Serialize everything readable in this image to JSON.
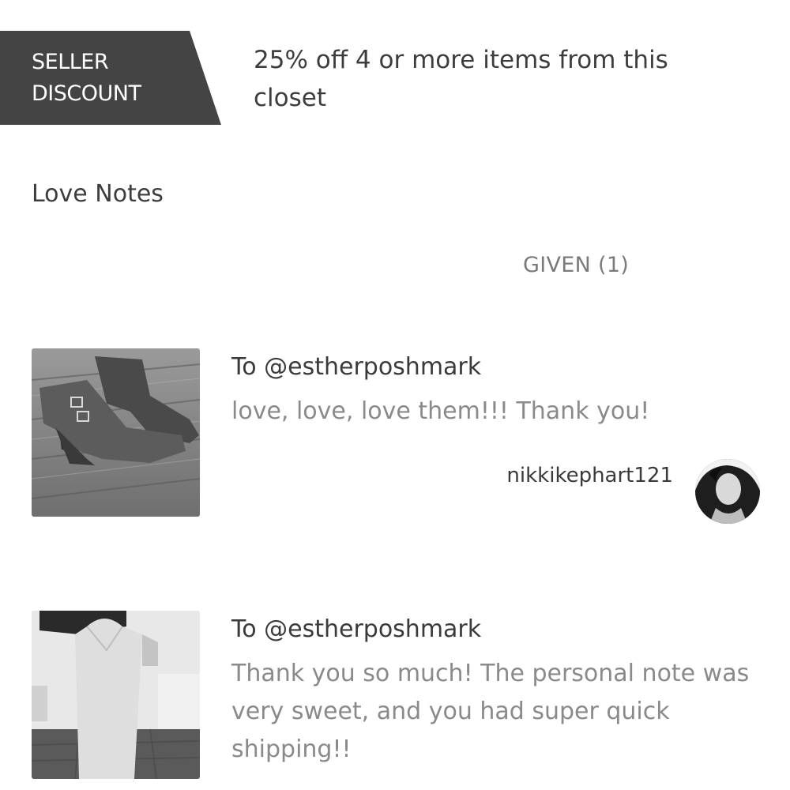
{
  "discount": {
    "tag_line1": "SELLER",
    "tag_line2": "DISCOUNT",
    "text": "25% off 4 or more items from this closet"
  },
  "love_notes": {
    "title": "Love Notes",
    "tab_given": "GIVEN (1)",
    "items": [
      {
        "to": "To @estherposhmark",
        "message": "love, love, love them!!! Thank you!",
        "author": "nikkikephart121",
        "thumbnail": "ankle-boots-photo",
        "avatar": "user-avatar-photo"
      },
      {
        "to": "To @estherposhmark",
        "message": "Thank you so much! The personal note was very sweet, and you had super quick shipping!!",
        "thumbnail": "white-dress-photo"
      }
    ]
  }
}
